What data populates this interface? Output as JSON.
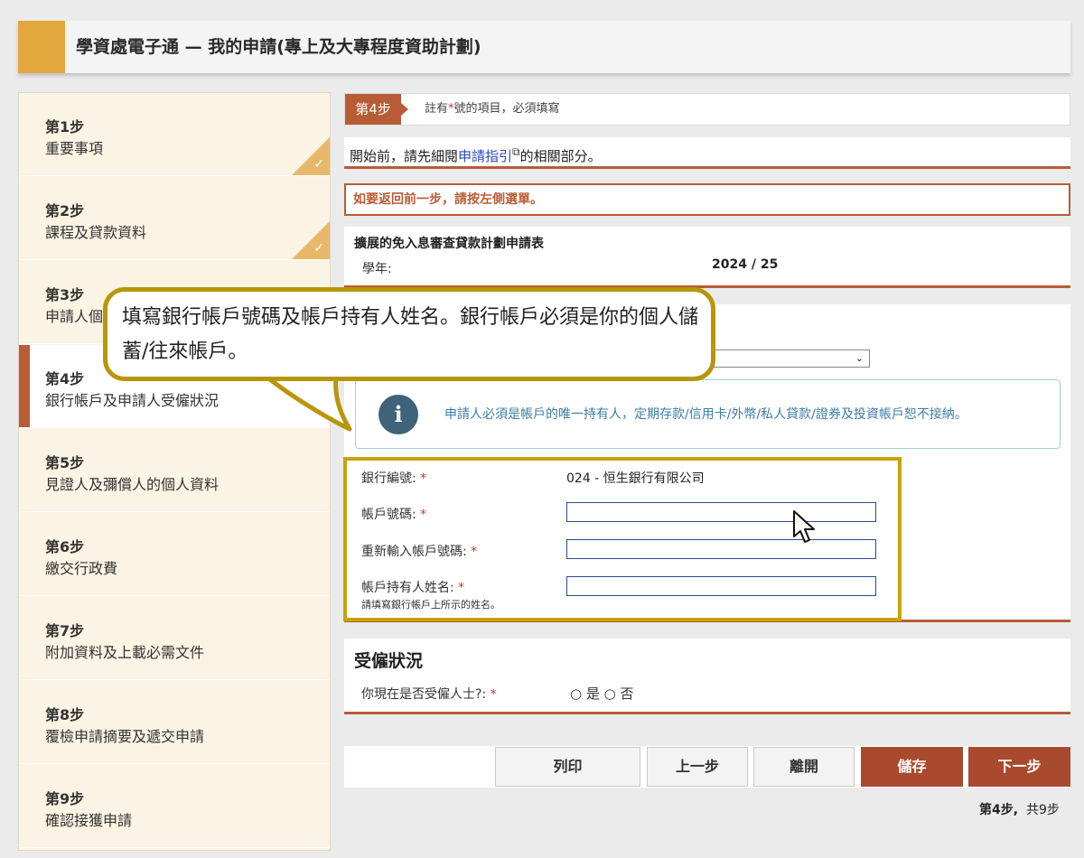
{
  "header": {
    "title": "學資處電子通 — 我的申請(專上及大專程度資助計劃)"
  },
  "sidebar": {
    "items": [
      {
        "num": "第1步",
        "label": "重要事項",
        "done": true
      },
      {
        "num": "第2步",
        "label": "課程及貸款資料",
        "done": true
      },
      {
        "num": "第3步",
        "label": "申請人個人資料"
      },
      {
        "num": "第4步",
        "label": "銀行帳戶及申請人受僱狀況",
        "active": true
      },
      {
        "num": "第5步",
        "label": "見證人及彌償人的個人資料"
      },
      {
        "num": "第6步",
        "label": "繳交行政費"
      },
      {
        "num": "第7步",
        "label": "附加資料及上載必需文件"
      },
      {
        "num": "第8步",
        "label": "覆檢申請摘要及遞交申請"
      },
      {
        "num": "第9步",
        "label": "確認接獲申請"
      }
    ],
    "check_glyph": "✓"
  },
  "stepbar": {
    "tag": "第4步",
    "note_pre": "註有",
    "note_star": "*",
    "note_post": "號的項目，必須填寫"
  },
  "guide": {
    "pre": "開始前，請先細閱",
    "link": "申請指引",
    "ext_icon": "⧉",
    "post": "的相關部分。"
  },
  "warning": "如要返回前一步，請按左側選單。",
  "form_header": {
    "title": "擴展的免入息審查貸款計劃申請表",
    "year_label": "學年:",
    "year_value": "2024 / 25"
  },
  "info": {
    "icon": "i",
    "text": "申請人必須是帳戶的唯一持有人，定期存款/信用卡/外幣/私人貸款/證券及投資帳戶恕不接納。"
  },
  "bank": {
    "code_label": "銀行編號:",
    "code_value": "024 - 恒生銀行有限公司",
    "acct_label": "帳戶號碼:",
    "acct_value": "",
    "reacct_label": "重新輸入帳戶號碼:",
    "reacct_value": "",
    "holder_label": "帳戶持有人姓名:",
    "holder_hint": "請填寫銀行帳戶上所示的姓名。",
    "holder_value": "",
    "req": "*"
  },
  "employment": {
    "title": "受僱狀況",
    "question": "你現在是否受僱人士?:",
    "req": "*",
    "options": "○ 是 ○ 否"
  },
  "buttons": {
    "print": "列印",
    "prev": "上一步",
    "leave": "離開",
    "save": "儲存",
    "next": "下一步"
  },
  "pager": {
    "current": "第4步,",
    "total": "共9步"
  },
  "callout": {
    "text": "填寫銀行帳戶號碼及帳戶持有人姓名。銀行帳戶必須是你的個人儲蓄/往來帳戶。"
  },
  "colors": {
    "brand": "#b85c36",
    "accent": "#e3a83d",
    "highlight": "#c8a20c",
    "link": "#2a4cb4"
  }
}
